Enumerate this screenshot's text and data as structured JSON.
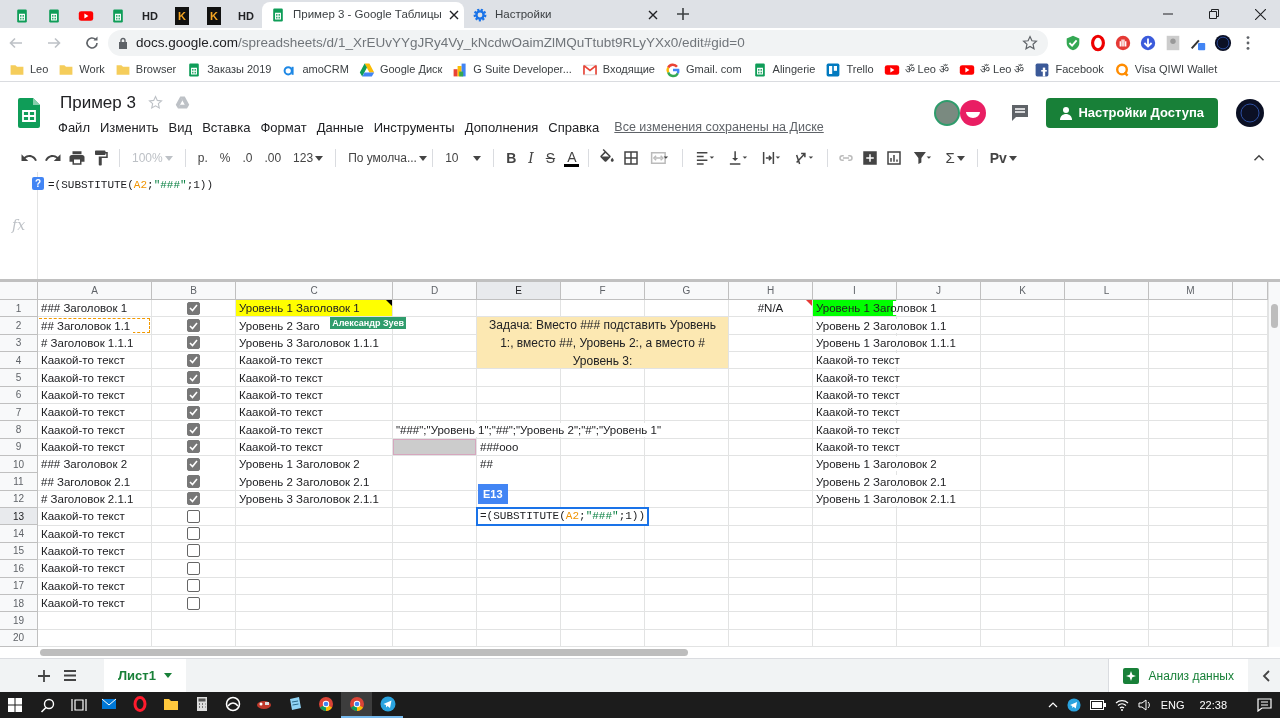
{
  "browser": {
    "tabs": [
      {
        "kind": "sheets",
        "selected": false
      },
      {
        "kind": "sheets",
        "selected": false
      },
      {
        "kind": "youtube",
        "selected": false
      },
      {
        "kind": "sheets",
        "selected": false
      },
      {
        "kind": "hd",
        "label": "HD",
        "selected": false
      },
      {
        "kind": "k",
        "label": "K",
        "selected": false
      },
      {
        "kind": "k",
        "label": "K",
        "selected": false
      },
      {
        "kind": "hd",
        "label": "HD",
        "selected": false
      },
      {
        "kind": "sheets",
        "title": "Пример 3 - Google Таблицы",
        "selected": true
      },
      {
        "kind": "settings",
        "title": "Настройки",
        "selected": false
      }
    ],
    "address": {
      "host": "docs.google.com",
      "path": "/spreadsheets/d/1_XrEUvYYgJRy4Vy_kNcdwOaimZlMQuTtubt9RLyYXx0/edit#gid=0"
    },
    "bookmarks": [
      {
        "kind": "folder",
        "label": "Leo"
      },
      {
        "kind": "folder",
        "label": "Work"
      },
      {
        "kind": "folder",
        "label": "Browser"
      },
      {
        "kind": "sheets",
        "label": "Заказы 2019"
      },
      {
        "kind": "amocrm",
        "label": "amoCRM"
      },
      {
        "kind": "drive",
        "label": "Google Диск"
      },
      {
        "kind": "gsuite",
        "label": "G Suite Developer..."
      },
      {
        "kind": "gmail",
        "label": "Входящие"
      },
      {
        "kind": "google",
        "label": "Gmail. com"
      },
      {
        "kind": "sheets",
        "label": "Alingerie"
      },
      {
        "kind": "trello",
        "label": "Trello"
      },
      {
        "kind": "youtube",
        "label": "ॐ Leo ॐ"
      },
      {
        "kind": "youtube",
        "label": "ॐ Leo ॐ"
      },
      {
        "kind": "facebook",
        "label": "Facebook"
      },
      {
        "kind": "qiwi",
        "label": "Visa QIWI Wallet"
      }
    ]
  },
  "document": {
    "title": "Пример 3",
    "menu": [
      "Файл",
      "Изменить",
      "Вид",
      "Вставка",
      "Формат",
      "Данные",
      "Инструменты",
      "Дополнения",
      "Справка"
    ],
    "save_status": "Все изменения сохранены на Диске",
    "share_button": "Настройки Доступа"
  },
  "toolbar": {
    "zoom": {
      "text": "100%",
      "disabled": true
    },
    "currency": "р.",
    "percent": "%",
    "decrease_decimals": ".0",
    "increase_decimals": ".00",
    "number_format": "123",
    "font": "По умолча...",
    "font_size": "10",
    "bold": "B",
    "italic": "I",
    "strikethrough": "S",
    "text_color": "A",
    "functions": "Σ",
    "addon": "Pv"
  },
  "formula_bar": {
    "help": "?",
    "fx": "fx",
    "segments": [
      {
        "text": "=(SUBSTITUTE(",
        "kind": "plain"
      },
      {
        "text": "A2",
        "kind": "reference"
      },
      {
        "text": ";",
        "kind": "plain"
      },
      {
        "text": "\"###\"",
        "kind": "string"
      },
      {
        "text": ";1))",
        "kind": "plain"
      }
    ]
  },
  "columns": [
    {
      "label": "A",
      "selected": false
    },
    {
      "label": "B",
      "selected": false
    },
    {
      "label": "C",
      "selected": false
    },
    {
      "label": "D",
      "selected": false
    },
    {
      "label": "E",
      "selected": true
    },
    {
      "label": "F",
      "selected": false
    },
    {
      "label": "G",
      "selected": false
    },
    {
      "label": "H",
      "selected": false
    },
    {
      "label": "I",
      "selected": false
    },
    {
      "label": "J",
      "selected": false
    },
    {
      "label": "K",
      "selected": false
    },
    {
      "label": "L",
      "selected": false
    },
    {
      "label": "M",
      "selected": false
    }
  ],
  "rows": [
    {
      "label": "1",
      "selected": false,
      "cells": {
        "A": "### Заголовок 1",
        "B": {
          "checked": true
        },
        "C": {
          "text": "Уровень 1 Заголовок 1",
          "color": "#ffff00",
          "note": true,
          "collaborator": "Александр Зуев"
        },
        "H": {
          "text": "#N/A",
          "error": true
        },
        "I": {
          "text": "Уровень 1 Заголовок 1",
          "color": "#00ff00"
        }
      }
    },
    {
      "label": "2",
      "selected": false,
      "cells": {
        "A": {
          "text": "## Заголовок 1.1",
          "copied": true
        },
        "B": {
          "checked": true
        },
        "C": "Уровень 2 Заго",
        "E": {
          "kind": "note",
          "text": "Задача: Вместо ### подставить Уровень 1:, вместо ##, Уровень 2:, а вместо # Уровень 3:"
        },
        "I": "Уровень 2 Заголовок 1.1"
      }
    },
    {
      "label": "3",
      "selected": false,
      "cells": {
        "A": "# Заголовок 1.1.1",
        "B": {
          "checked": true
        },
        "C": "Уровень 3 Заголовок 1.1.1",
        "I": "Уровень 1 Заголовок 1.1.1"
      }
    },
    {
      "label": "4",
      "selected": false,
      "cells": {
        "A": "Каакой-то текст",
        "B": {
          "checked": true
        },
        "C": "Каакой-то текст",
        "I": "Каакой-то текст"
      }
    },
    {
      "label": "5",
      "selected": false,
      "cells": {
        "A": "Каакой-то текст",
        "B": {
          "checked": true
        },
        "C": "Каакой-то текст",
        "I": "Каакой-то текст"
      }
    },
    {
      "label": "6",
      "selected": false,
      "cells": {
        "A": "Каакой-то текст",
        "B": {
          "checked": true
        },
        "C": "Каакой-то текст",
        "I": "Каакой-то текст"
      }
    },
    {
      "label": "7",
      "selected": false,
      "cells": {
        "A": "Каакой-то текст",
        "B": {
          "checked": true
        },
        "C": "Каакой-то текст",
        "I": "Каакой-то текст"
      }
    },
    {
      "label": "8",
      "selected": false,
      "cells": {
        "A": "Каакой-то текст",
        "B": {
          "checked": true
        },
        "C": "Каакой-то текст",
        "D": "\"###\";\"Уровень 1\";\"##\";\"Уровень 2\";\"#\";\"Уровень 1\"",
        "I": "Каакой-то текст"
      }
    },
    {
      "label": "9",
      "selected": false,
      "cells": {
        "A": "Каакой-то текст",
        "B": {
          "checked": true
        },
        "C": "Каакой-то текст",
        "D": {
          "kind": "collaborator_selection"
        },
        "E": "###ooo",
        "I": "Каакой-то текст"
      }
    },
    {
      "label": "10",
      "selected": false,
      "cells": {
        "A": "### Заголовок 2",
        "B": {
          "checked": true
        },
        "C": "Уровень 1 Заголовок 2",
        "E": "##",
        "I": "Уровень 1 Заголовок 2"
      }
    },
    {
      "label": "11",
      "selected": false,
      "cells": {
        "A": "## Заголовок 2.1",
        "B": {
          "checked": true
        },
        "C": "Уровень 2 Заголовок 2.1",
        "I": "Уровень 2 Заголовок 2.1"
      }
    },
    {
      "label": "12",
      "selected": false,
      "cells": {
        "A": "# Заголовок 2.1.1",
        "B": {
          "checked": true
        },
        "C": "Уровень 3 Заголовок 2.1.1",
        "I": "Уровень 1 Заголовок 2.1.1"
      }
    },
    {
      "label": "13",
      "selected": true,
      "cells": {
        "A": "Каакой-то текст",
        "B": {
          "checked": false
        },
        "E": {
          "kind": "editor",
          "label": "E13",
          "segments": [
            {
              "text": "=(SUBSTITUTE(",
              "kind": "plain"
            },
            {
              "text": "A2",
              "kind": "reference"
            },
            {
              "text": ";",
              "kind": "plain"
            },
            {
              "text": "\"###\"",
              "kind": "string"
            },
            {
              "text": ";1))",
              "kind": "plain"
            }
          ]
        }
      }
    },
    {
      "label": "14",
      "selected": false,
      "cells": {
        "A": "Каакой-то текст",
        "B": {
          "checked": false
        }
      }
    },
    {
      "label": "15",
      "selected": false,
      "cells": {
        "A": "Каакой-то текст",
        "B": {
          "checked": false
        }
      }
    },
    {
      "label": "16",
      "selected": false,
      "cells": {
        "A": "Каакой-то текст",
        "B": {
          "checked": false
        }
      }
    },
    {
      "label": "17",
      "selected": false,
      "cells": {
        "A": "Каакой-то текст",
        "B": {
          "checked": false
        }
      }
    },
    {
      "label": "18",
      "selected": false,
      "cells": {
        "A": "Каакой-то текст",
        "B": {
          "checked": false
        }
      }
    },
    {
      "label": "19",
      "selected": false
    },
    {
      "label": "20",
      "selected": false
    }
  ],
  "sheet_bar": {
    "sheets": [
      {
        "label": "Лист1",
        "selected": true
      }
    ],
    "explore_button": "Анализ данных"
  },
  "taskbar": {
    "apps": [
      {
        "kind": "mail",
        "active": false,
        "running": false
      },
      {
        "kind": "opera",
        "active": false,
        "running": false
      },
      {
        "kind": "folder",
        "active": false,
        "running": false
      },
      {
        "kind": "calculator",
        "active": false,
        "running": false
      },
      {
        "kind": "round",
        "active": false,
        "running": false
      },
      {
        "kind": "game",
        "active": false,
        "running": false
      },
      {
        "kind": "notepad",
        "active": false,
        "running": false
      },
      {
        "kind": "chrome",
        "active": false,
        "running": false
      },
      {
        "kind": "chrome",
        "active": true,
        "running": true
      },
      {
        "kind": "telegram",
        "active": false,
        "running": true
      }
    ],
    "language": "ENG",
    "time": "22:38"
  }
}
